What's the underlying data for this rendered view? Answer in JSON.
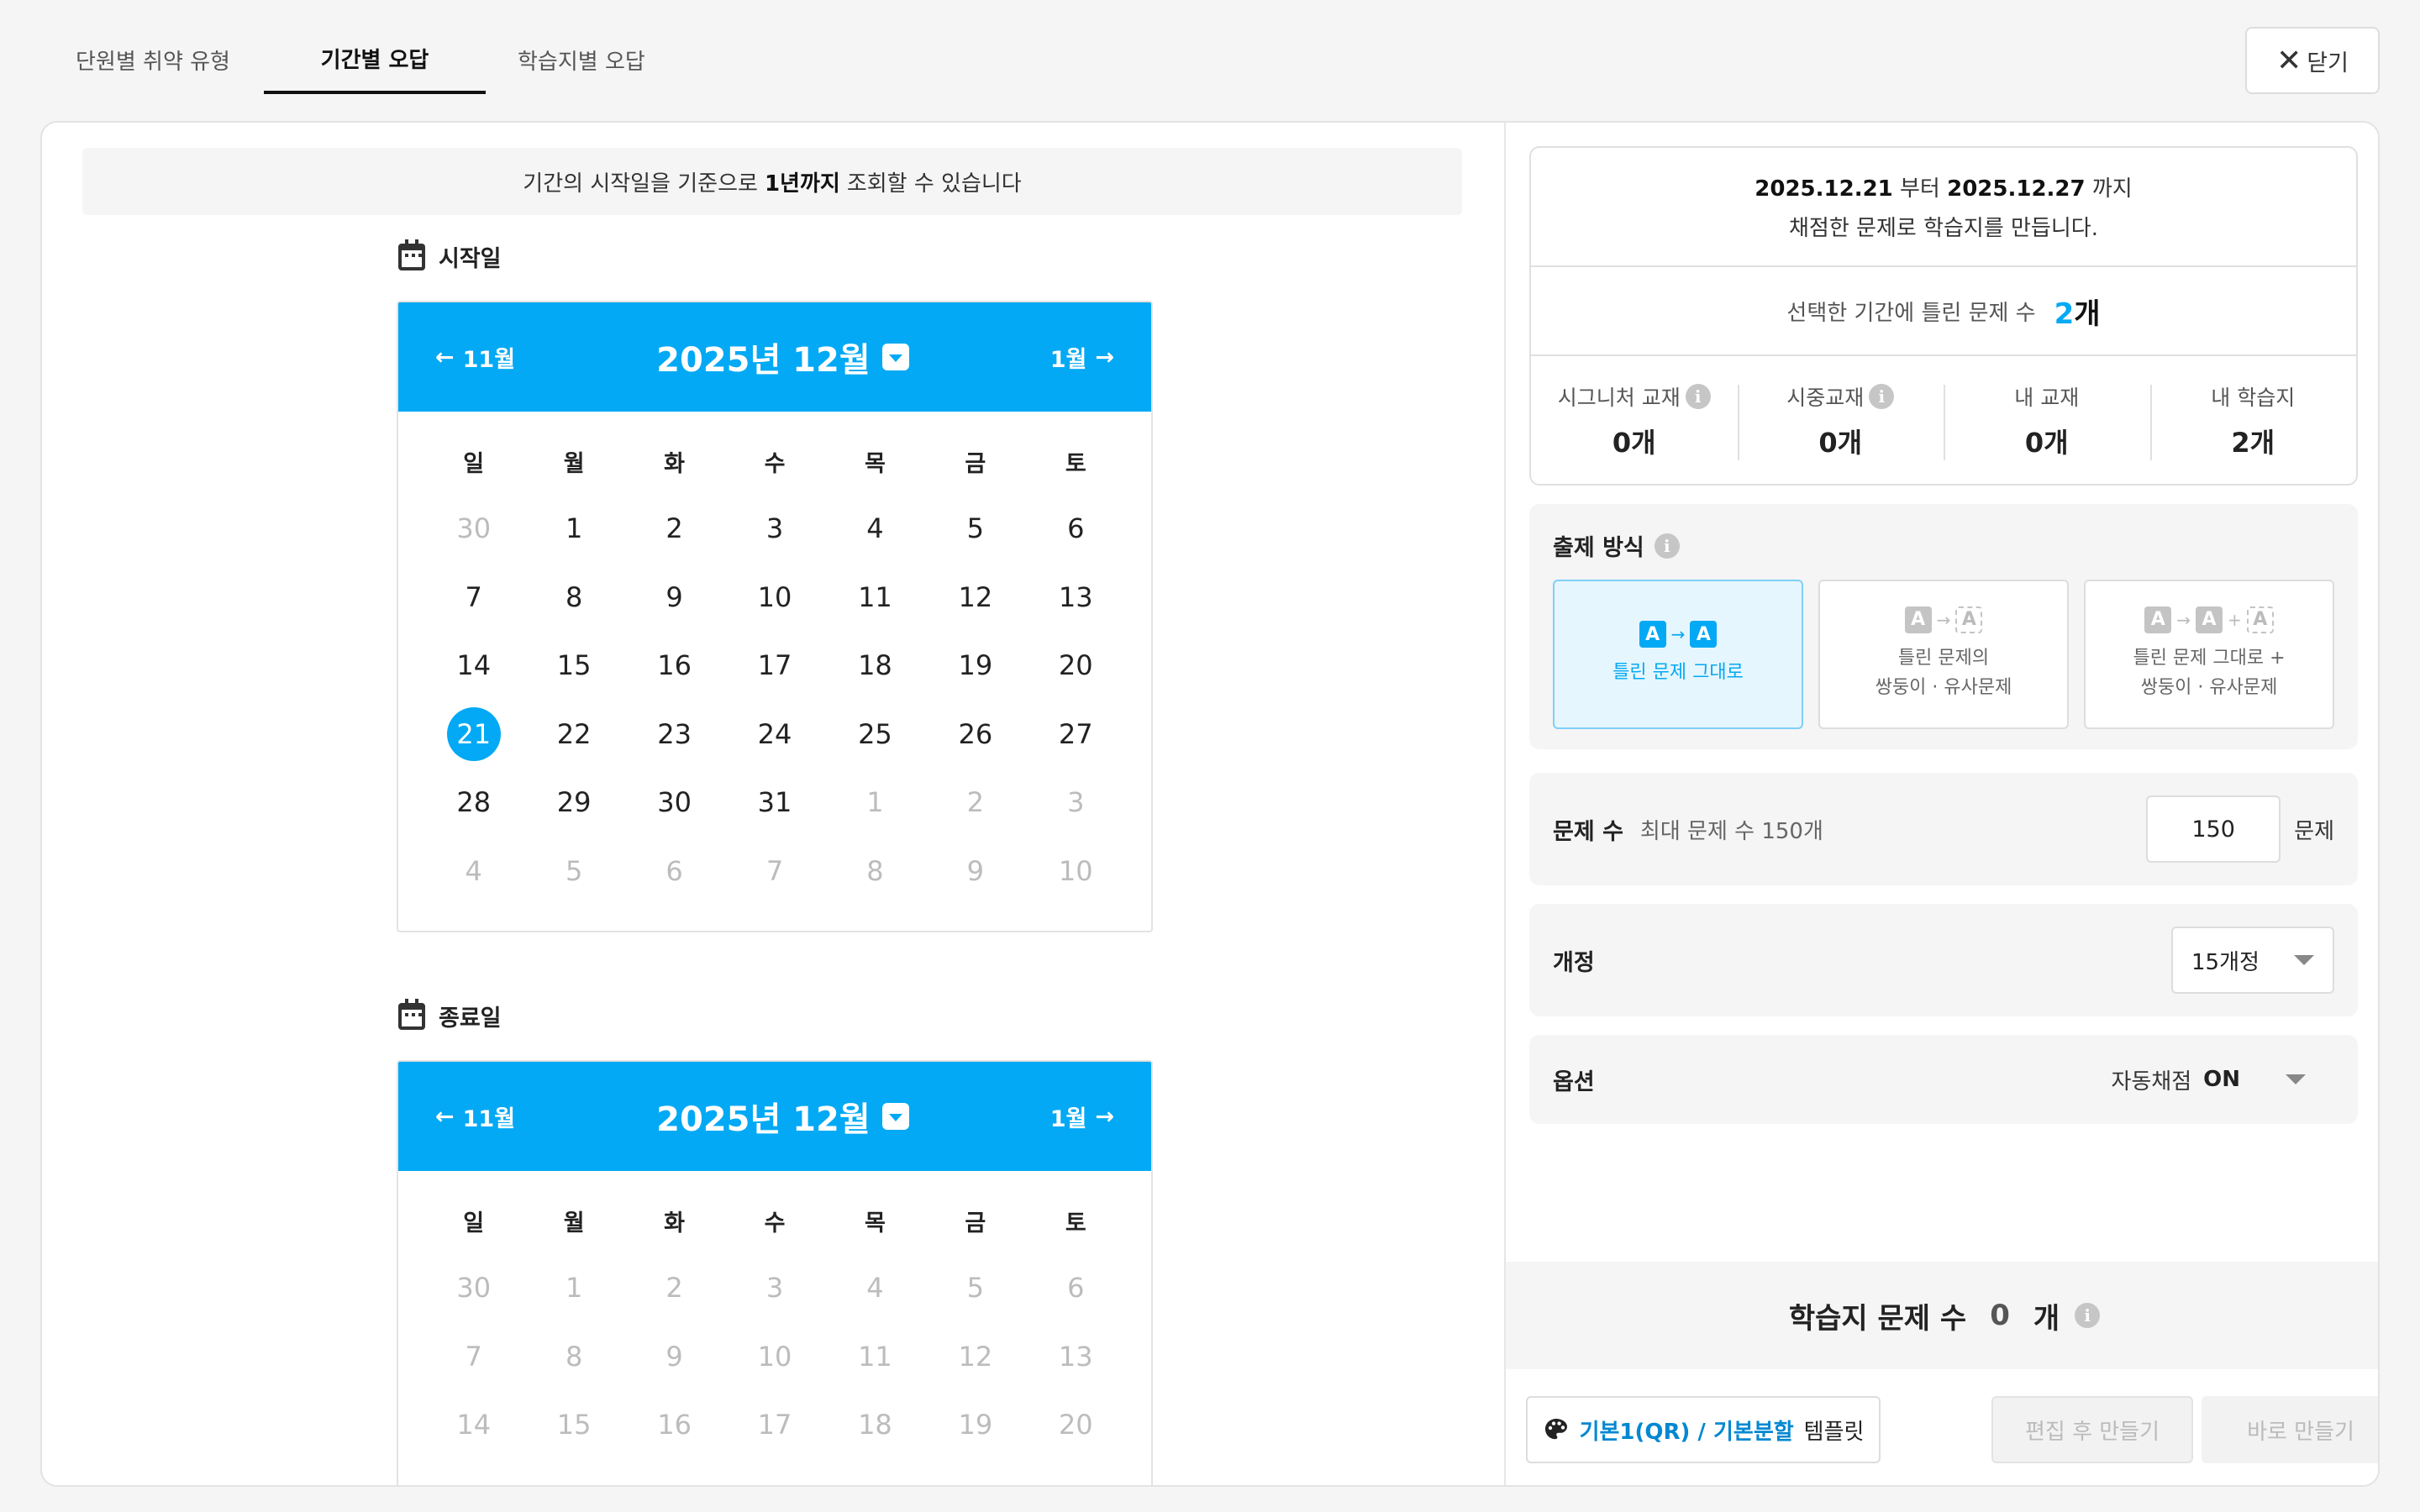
{
  "tabs": [
    {
      "label": "단원별 취약 유형"
    },
    {
      "label": "기간별 오답"
    },
    {
      "label": "학습지별 오답"
    }
  ],
  "close_button": {
    "label": "닫기",
    "icon": "close-icon"
  },
  "notice": {
    "prefix": "기간의 시작일을 기준으로",
    "emphasis": "1년까지",
    "suffix": "조회할 수 있습니다"
  },
  "start_calendar": {
    "label": "시작일",
    "prev": "11월",
    "title": "2025년 12월",
    "next": "1월",
    "weekdays": [
      "일",
      "월",
      "화",
      "수",
      "목",
      "금",
      "토"
    ],
    "days": [
      "30",
      "1",
      "2",
      "3",
      "4",
      "5",
      "6",
      "7",
      "8",
      "9",
      "10",
      "11",
      "12",
      "13",
      "14",
      "15",
      "16",
      "17",
      "18",
      "19",
      "20",
      "21",
      "22",
      "23",
      "24",
      "25",
      "26",
      "27",
      "28",
      "29",
      "30",
      "31",
      "1",
      "2",
      "3",
      "4",
      "5",
      "6",
      "7",
      "8",
      "9",
      "10"
    ],
    "selected": "21"
  },
  "end_calendar": {
    "label": "종료일",
    "prev": "11월",
    "title": "2025년 12월",
    "next": "1월",
    "weekdays": [
      "일",
      "월",
      "화",
      "수",
      "목",
      "금",
      "토"
    ],
    "days": [
      "30",
      "1",
      "2",
      "3",
      "4",
      "5",
      "6",
      "7",
      "8",
      "9",
      "10",
      "11",
      "12",
      "13",
      "14",
      "15",
      "16",
      "17",
      "18",
      "19",
      "20"
    ]
  },
  "summary": {
    "from": "2025.12.21",
    "from_word": "부터",
    "to": "2025.12.27",
    "to_word": "까지",
    "line2": "채점한 문제로 학습지를 만듭니다.",
    "wrong_label": "선택한 기간에 틀린 문제 수",
    "wrong_count": "2",
    "wrong_unit": "개",
    "stats": [
      {
        "label": "시그니처 교재",
        "value": "0개",
        "info": true
      },
      {
        "label": "시중교재",
        "value": "0개",
        "info": true
      },
      {
        "label": "내 교재",
        "value": "0개",
        "info": false
      },
      {
        "label": "내 학습지",
        "value": "2개",
        "info": false
      }
    ]
  },
  "method": {
    "title": "출제 방식",
    "options": [
      {
        "line1": "틀린 문제 그대로",
        "line2": ""
      },
      {
        "line1": "틀린 문제의",
        "line2": "쌍둥이 · 유사문제"
      },
      {
        "line1": "틀린 문제 그대로 +",
        "line2": "쌍둥이 · 유사문제"
      }
    ]
  },
  "problem_count": {
    "title": "문제 수",
    "hint": "최대 문제 수 150개",
    "value": "150",
    "unit": "문제"
  },
  "revision": {
    "title": "개정",
    "value": "15개정"
  },
  "options": {
    "title": "옵션",
    "label": "자동채점",
    "value": "ON"
  },
  "total": {
    "label": "학습지 문제 수",
    "value": "0",
    "unit": "개"
  },
  "footer": {
    "template_strong": "기본1(QR) / 기본분할",
    "template_suffix": "템플릿",
    "edit_button": "편집 후 만들기",
    "make_button": "바로 만들기"
  },
  "colors": {
    "accent": "#03a9f4",
    "disabled": "#bbbbbb"
  }
}
